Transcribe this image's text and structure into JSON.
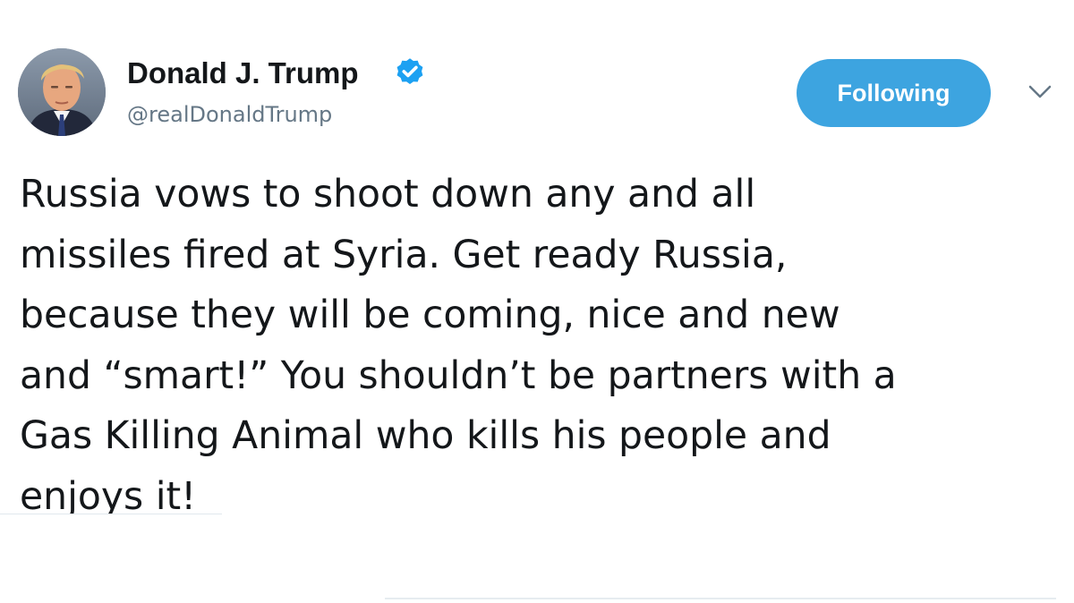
{
  "tweet": {
    "author": {
      "display_name": "Donald J. Trump",
      "handle": "@realDonaldTrump",
      "verified": true,
      "verified_icon": "verified-badge-icon",
      "avatar_icon": "profile-avatar"
    },
    "follow_button_label": "Following",
    "menu_icon": "chevron-down-icon",
    "text_lines": [
      "Russia vows to shoot down any and all",
      "missiles fired at Syria. Get ready Russia,",
      "because they will be coming, nice and new",
      "and “smart!” You shouldn’t be partners with a",
      "Gas Killing Animal who kills his people and",
      "enjoys it!"
    ]
  },
  "colors": {
    "accent": "#3da4e0",
    "verified": "#1da1f2",
    "handle_text": "#657786",
    "body_text": "#14171a"
  }
}
